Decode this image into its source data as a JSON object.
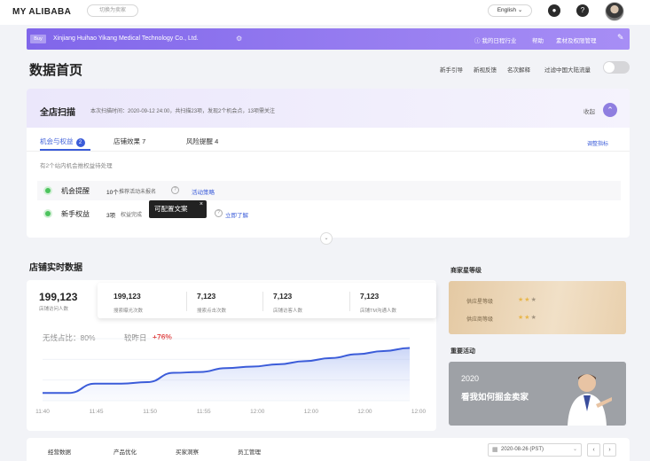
{
  "topbar": {
    "brand": "MY ALIBABA",
    "switch_label": "切换为卖家",
    "language": "English",
    "icons": [
      "bell-icon",
      "help-icon",
      "avatar"
    ]
  },
  "company_bar": {
    "tag": "Buy",
    "company": "Xinjiang Huihao Yikang Medical Technology Co., Ltd.",
    "links": [
      "我的日程行业",
      "帮助",
      "素材及权限管理"
    ]
  },
  "page": {
    "title": "数据首页",
    "tools": [
      "新手引导",
      "新视反馈",
      "名次解释"
    ],
    "toggle_label": "过滤中国大陆流量"
  },
  "scan": {
    "title": "全店扫描",
    "time": "本次扫描时间：2020-09-12 24:00，共扫描23项，发现2个机会点，13项需关注",
    "collapse": "收起",
    "tabs": [
      {
        "label": "机会与权益",
        "count": "2"
      },
      {
        "label": "店铺效果",
        "count": "7"
      },
      {
        "label": "风险提醒",
        "count": "4"
      }
    ],
    "adjust": "调整指标",
    "hint": "有2个站内机会推权益待处理",
    "rows": [
      {
        "title": "机会提醒",
        "count": "10个",
        "desc": "推荐活动未报名",
        "link": "活动策略"
      },
      {
        "title": "新手权益",
        "count": "3项",
        "desc": "权益完成",
        "link": "立即了解"
      }
    ],
    "tooltip": "可配置文案"
  },
  "realtime": {
    "title": "店铺实时数据",
    "main_value": "199,123",
    "main_label": "店铺访问人数",
    "metrics": [
      {
        "value": "199,123",
        "label": "搜索曝光次数"
      },
      {
        "value": "7,123",
        "label": "搜索点击次数"
      },
      {
        "value": "7,123",
        "label": "店铺访客人数"
      },
      {
        "value": "7,123",
        "label": "店铺TM沟通人数"
      }
    ],
    "ratio_label": "无线占比：80%",
    "yoy_label": "较昨日",
    "yoy_value": "+76%"
  },
  "chart_data": {
    "type": "area",
    "x": [
      "11:40",
      "11:45",
      "11:50",
      "11:55",
      "12:00",
      "12:00",
      "12:00",
      "12:00"
    ],
    "series": [
      {
        "values": [
          10,
          10,
          22,
          22,
          24,
          36,
          37,
          42,
          44,
          47,
          51,
          55,
          60,
          64,
          68
        ]
      }
    ],
    "ylim": [
      0,
      80
    ],
    "color": "#3b5cd9"
  },
  "side": {
    "star_title": "商家星等级",
    "star_rows": [
      {
        "label": "供应星等级",
        "stars": 2,
        "max": 3
      },
      {
        "label": "供应商等级",
        "stars": 2,
        "max": 3
      }
    ],
    "event_title": "重要活动",
    "event_year": "2020",
    "event_text": "看我如何掘金卖家"
  },
  "bottom": {
    "tabs": [
      "经营数据",
      "产品优化",
      "买家洞察",
      "员工管理"
    ],
    "date": "2020-08-26 (PST)"
  }
}
